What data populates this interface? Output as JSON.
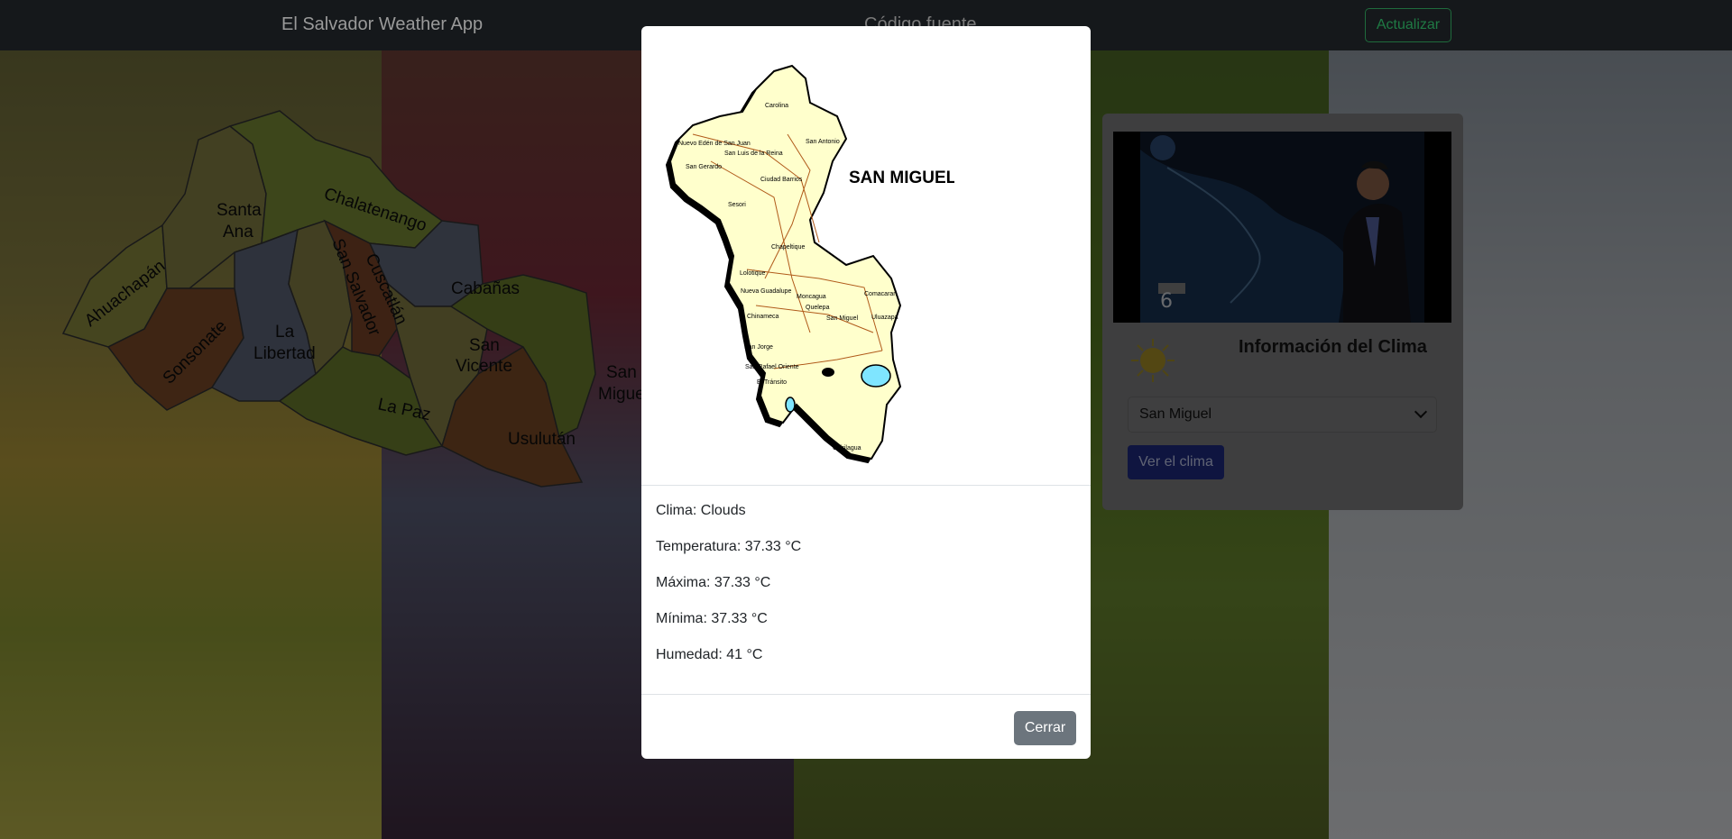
{
  "navbar": {
    "brand": "El Salvador Weather App",
    "link": "Código fuente",
    "update_button": "Actualizar"
  },
  "map": {
    "departments": [
      "Ahuachapán",
      "Santa",
      "Ana",
      "Chalatenango",
      "Sonsonate",
      "La",
      "Libertad",
      "San Salvador",
      "Cuscatlán",
      "Cabañas",
      "San",
      "Vicente",
      "La Paz",
      "Usulután",
      "San",
      "Migue"
    ]
  },
  "card": {
    "title": "Información del Clima",
    "selected_city": "San Miguel",
    "view_button": "Ver el clima"
  },
  "modal": {
    "map_title": "SAN MIGUEL",
    "towns": [
      "Carolina",
      "Nuevo Edén de San Juan",
      "San Antonio",
      "San Luis de la Reina",
      "San Gerardo",
      "Ciudad Barrios",
      "Sesori",
      "Chapeltique",
      "Lolotique",
      "Nueva Guadalupe",
      "Moncagua",
      "Comacaran",
      "Quelepa",
      "Chinameca",
      "San Miguel",
      "Uluazapa",
      "San Jorge",
      "San Rafael Oriente",
      "El Tránsito",
      "Chirilagua"
    ],
    "clima": "Clima: Clouds",
    "temperatura": "Temperatura: 37.33 °C",
    "maxima": "Máxima: 37.33 °C",
    "minima": "Mínima: 37.33 °C",
    "humedad": "Humedad: 41 °C",
    "close_button": "Cerrar"
  },
  "colors": {
    "modal_bg": "#ffffff",
    "close_button_bg": "#6c757d",
    "update_button_border": "#198754",
    "view_button_bg": "#0d6efd",
    "map_fill": "#ffffcc",
    "lake_fill": "#7fe5ff"
  },
  "icons": {
    "weather": "sun-icon",
    "dropdown": "chevron-down-icon"
  }
}
